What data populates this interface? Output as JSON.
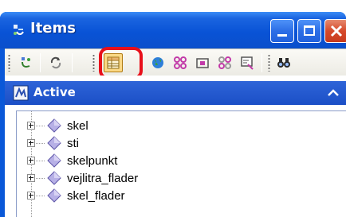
{
  "window": {
    "title": "Items",
    "title_icon": "items-icon",
    "controls": [
      "minimize-icon",
      "maximize-icon",
      "close-icon"
    ]
  },
  "toolbar": {
    "tools": [
      {
        "icon": "items-icon",
        "active": false
      },
      {
        "icon": "refresh-icon",
        "active": false
      },
      {
        "icon": "table-view-icon",
        "active": true,
        "highlighted": true
      },
      {
        "icon": "globe-icon",
        "active": false
      },
      {
        "icon": "link-icon",
        "active": false
      },
      {
        "icon": "frame-icon",
        "active": false
      },
      {
        "icon": "unlink-icon",
        "active": false
      },
      {
        "icon": "properties-icon",
        "active": false
      },
      {
        "icon": "binoculars-icon",
        "active": false
      }
    ]
  },
  "panel": {
    "title": "Active",
    "icon": "workspace-icon",
    "collapse_icon": "chevron-up-icon"
  },
  "tree": {
    "items": [
      {
        "label": "skel"
      },
      {
        "label": "sti"
      },
      {
        "label": "skelpunkt"
      },
      {
        "label": "vejlitra_flader"
      },
      {
        "label": "skel_flader"
      }
    ]
  },
  "colors": {
    "titlebar": "#0953d6",
    "highlight_ring": "#e8101a",
    "active_tool": "#fbd986",
    "item_diamond": "#9a8fd6"
  }
}
